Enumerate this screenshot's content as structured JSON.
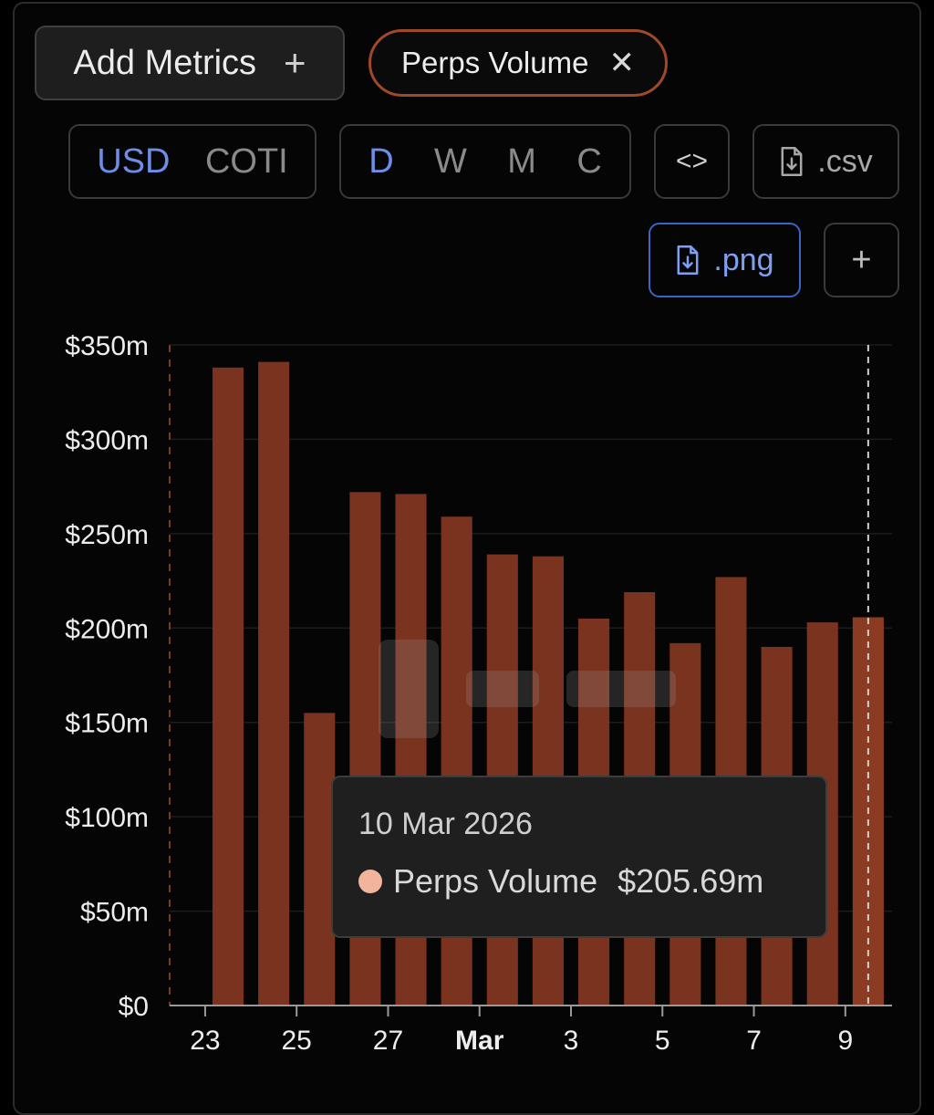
{
  "toolbar": {
    "add_metrics_label": "Add Metrics",
    "add_metrics_icon": "plus-icon",
    "metric_chip_label": "Perps Volume",
    "metric_chip_remove_icon": "close-icon",
    "currency_options": [
      "USD",
      "COTI"
    ],
    "currency_selected": "USD",
    "period_options": [
      "D",
      "W",
      "M",
      "C"
    ],
    "period_selected": "D",
    "embed_label": "<>",
    "csv_label": ".csv",
    "png_label": ".png",
    "add_label": "+"
  },
  "colors": {
    "bar": "#7a331e",
    "bar_highlight": "#8a3b22",
    "chip_border": "#a0482a",
    "active_accent": "#6c8ee6",
    "tooltip_dot": "#f2b59b"
  },
  "tooltip": {
    "date": "10 Mar 2026",
    "series": "Perps Volume",
    "value": "$205.69m"
  },
  "chart_data": {
    "type": "bar",
    "title": "",
    "xlabel": "",
    "ylabel": "",
    "ylim": [
      0,
      350
    ],
    "y_ticks": [
      "$0",
      "$50m",
      "$100m",
      "$150m",
      "$200m",
      "$250m",
      "$300m",
      "$350m"
    ],
    "x_tick_labels": [
      "23",
      "25",
      "27",
      "Mar",
      "3",
      "5",
      "7",
      "9"
    ],
    "categories": [
      "24 Feb",
      "25 Feb",
      "26 Feb",
      "27 Feb",
      "28 Feb",
      "1 Mar",
      "2 Mar",
      "3 Mar",
      "4 Mar",
      "5 Mar",
      "6 Mar",
      "7 Mar",
      "8 Mar",
      "9 Mar",
      "10 Mar"
    ],
    "series": [
      {
        "name": "Perps Volume",
        "values": [
          338,
          341,
          155,
          272,
          271,
          259,
          239,
          238,
          205,
          219,
          192,
          227,
          190,
          203,
          205.69
        ]
      }
    ],
    "grid": true,
    "legend": "none"
  }
}
